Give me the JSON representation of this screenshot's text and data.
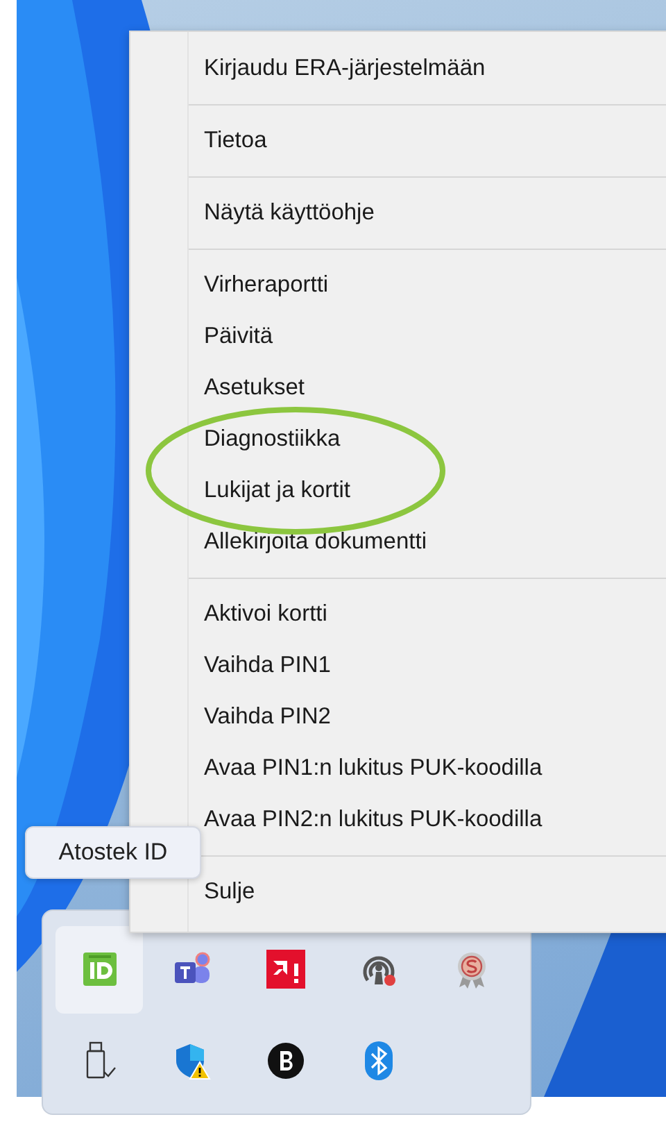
{
  "context_menu": {
    "groups": [
      [
        {
          "label": "Kirjaudu ERA-järjestelmään"
        }
      ],
      [
        {
          "label": "Tietoa"
        }
      ],
      [
        {
          "label": "Näytä käyttöohje"
        }
      ],
      [
        {
          "label": "Virheraportti"
        },
        {
          "label": "Päivitä"
        },
        {
          "label": "Asetukset"
        },
        {
          "label": "Diagnostiikka"
        },
        {
          "label": "Lukijat ja kortit"
        },
        {
          "label": "Allekirjoita dokumentti"
        }
      ],
      [
        {
          "label": "Aktivoi kortti"
        },
        {
          "label": "Vaihda PIN1"
        },
        {
          "label": "Vaihda PIN2"
        },
        {
          "label": "Avaa PIN1:n lukitus PUK-koodilla"
        },
        {
          "label": "Avaa PIN2:n lukitus PUK-koodilla"
        }
      ],
      [
        {
          "label": "Sulje"
        }
      ]
    ]
  },
  "tooltip": {
    "text": "Atostek ID"
  },
  "tray_flyout": {
    "icons": [
      {
        "kind": "id-card",
        "selected": true
      },
      {
        "kind": "teams",
        "selected": false
      },
      {
        "kind": "amd",
        "selected": false
      },
      {
        "kind": "broadcast",
        "selected": false
      },
      {
        "kind": "medal",
        "selected": false
      },
      {
        "kind": "usb",
        "selected": false
      },
      {
        "kind": "shield",
        "selected": false
      },
      {
        "kind": "b-circle",
        "selected": false
      },
      {
        "kind": "bluetooth",
        "selected": false
      }
    ]
  }
}
